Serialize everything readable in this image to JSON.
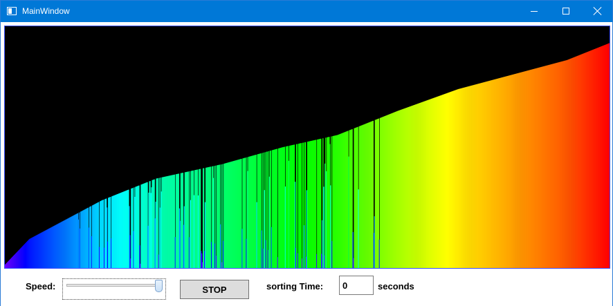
{
  "window": {
    "title": "MainWindow",
    "controls": {
      "minimize": "minimize",
      "maximize": "maximize",
      "close": "close"
    }
  },
  "colors": {
    "titlebar": "#0078d7",
    "canvas_background": "#000000",
    "canvas_border": "#3a50ff"
  },
  "visualization": {
    "description_type": "bar array being sorted, bars colored by value along a hue gradient",
    "hue_range_deg": [
      270,
      0
    ],
    "bar_count": 868,
    "height_profile": [
      [
        0,
        0.015
      ],
      [
        0.04,
        0.12
      ],
      [
        0.1,
        0.2
      ],
      [
        0.16,
        0.28
      ],
      [
        0.25,
        0.37
      ],
      [
        0.36,
        0.43
      ],
      [
        0.46,
        0.5
      ],
      [
        0.55,
        0.55
      ],
      [
        0.65,
        0.65
      ],
      [
        0.75,
        0.74
      ],
      [
        0.84,
        0.8
      ],
      [
        0.93,
        0.86
      ],
      [
        1.0,
        0.93
      ]
    ],
    "unsorted_region": [
      0.12,
      0.62
    ]
  },
  "controls": {
    "speed_label": "Speed:",
    "speed_value": 1.0,
    "stop_label": "STOP",
    "sorting_time_label": "sorting Time:",
    "sorting_time_value": "0",
    "seconds_label": "seconds"
  }
}
